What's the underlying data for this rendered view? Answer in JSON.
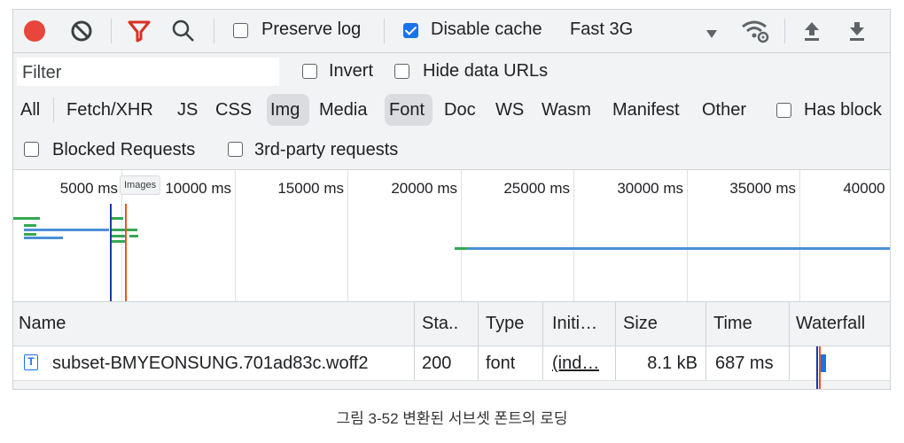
{
  "toolbar": {
    "record_icon": "record-icon",
    "clear_icon": "clear-icon",
    "filter_icon": "filter-icon",
    "search_icon": "search-icon",
    "preserve_log_label": "Preserve log",
    "preserve_log_checked": false,
    "disable_cache_label": "Disable cache",
    "disable_cache_checked": true,
    "throttling_value": "Fast 3G",
    "dropdown_icon": "dropdown-arrow-icon",
    "network_conditions_icon": "wifi-settings-icon",
    "import_icon": "upload-icon",
    "export_icon": "download-icon",
    "record_color": "#e8453c",
    "filter_color": "#d93025"
  },
  "filter": {
    "placeholder": "Filter",
    "invert_label": "Invert",
    "hide_data_urls_label": "Hide data URLs"
  },
  "types": {
    "items": [
      "All",
      "Fetch/XHR",
      "JS",
      "CSS",
      "Img",
      "Media",
      "Font",
      "Doc",
      "WS",
      "Wasm",
      "Manifest",
      "Other"
    ],
    "highlighted": [
      "Img",
      "Font"
    ],
    "has_blocked_label": "Has block"
  },
  "blocked": {
    "blocked_requests_label": "Blocked Requests",
    "third_party_label": "3rd-party requests"
  },
  "overview": {
    "ticks": [
      "5000 ms",
      "10000 ms",
      "15000 ms",
      "20000 ms",
      "25000 ms",
      "30000 ms",
      "35000 ms",
      "40000 ms"
    ],
    "tooltip": "Images"
  },
  "table": {
    "columns": [
      "Name",
      "Sta..",
      "Type",
      "Initi…",
      "Size",
      "Time",
      "Waterfall"
    ],
    "rows": [
      {
        "icon": "font-file-icon",
        "name": "subset-BMYEONSUNG.701ad83c.woff2",
        "status": "200",
        "type": "font",
        "initiator": "(ind…",
        "size": "8.1 kB",
        "time": "687 ms"
      }
    ]
  },
  "caption": "그림 3-52 변환된 서브셋 폰트의 로딩"
}
